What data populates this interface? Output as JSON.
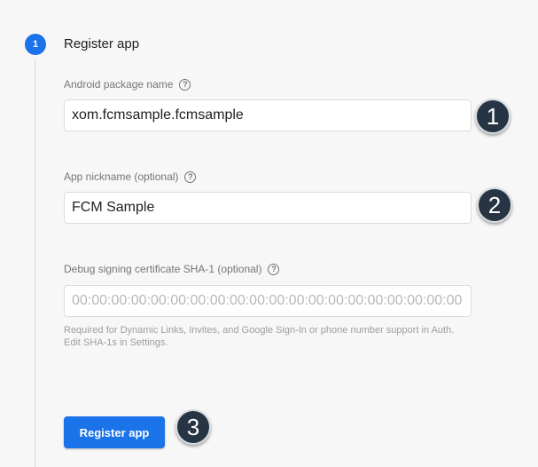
{
  "step": {
    "number": "1",
    "title": "Register app"
  },
  "fields": {
    "package_name": {
      "label": "Android package name",
      "value": "xom.fcmsample.fcmsample"
    },
    "nickname": {
      "label": "App nickname (optional)",
      "value": "FCM Sample"
    },
    "sha1": {
      "label": "Debug signing certificate SHA-1 (optional)",
      "placeholder": "00:00:00:00:00:00:00:00:00:00:00:00:00:00:00:00:00:00:00:00",
      "hint": "Required for Dynamic Links, Invites, and Google Sign-In or phone number support in Auth. Edit SHA-1s in Settings."
    }
  },
  "help_icon_glyph": "?",
  "register_button": {
    "label": "Register app"
  },
  "callouts": [
    "1",
    "2",
    "3"
  ],
  "colors": {
    "accent": "#1a73e8",
    "callout_bg": "#263443",
    "background": "#f7f7f7"
  }
}
